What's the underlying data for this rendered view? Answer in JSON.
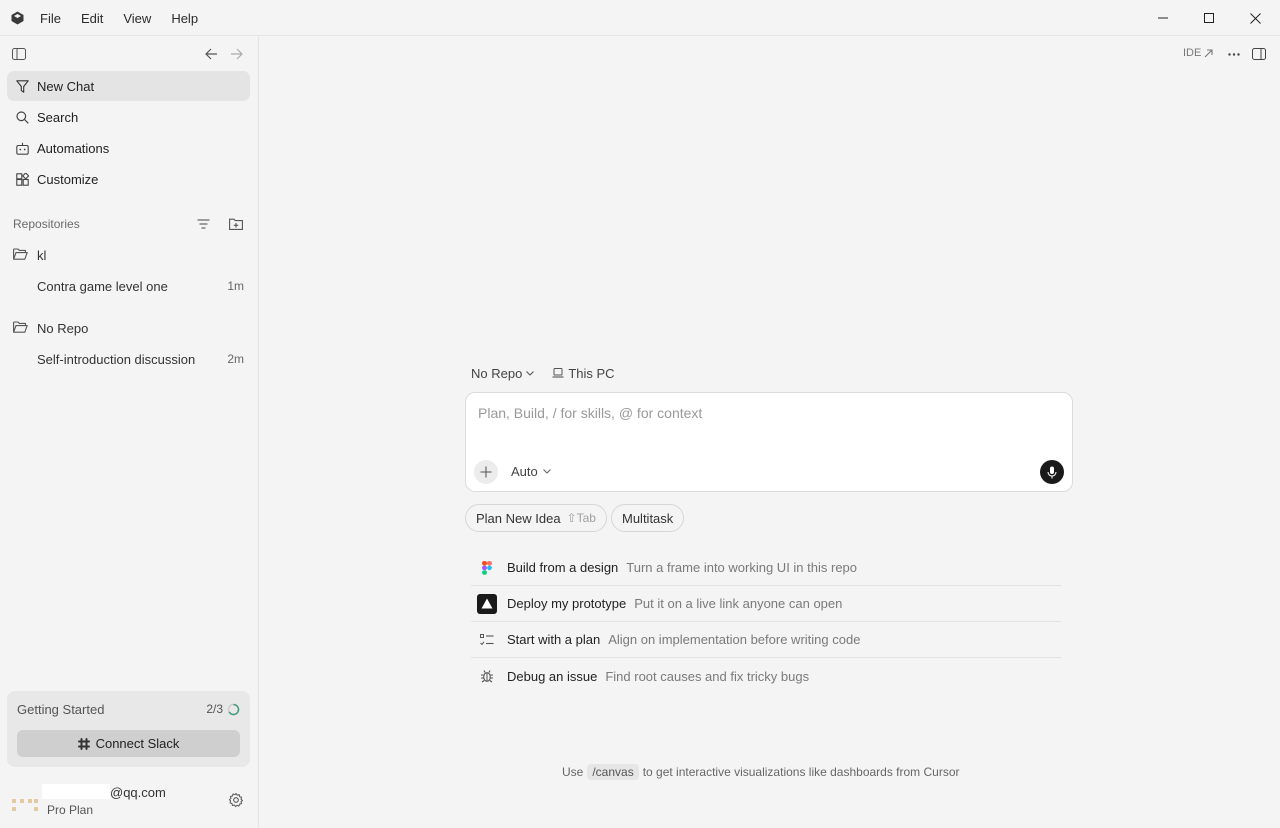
{
  "menu": [
    "File",
    "Edit",
    "View",
    "Help"
  ],
  "sidebar": {
    "nav": [
      {
        "label": "New Chat",
        "icon": "new-chat-icon",
        "active": true
      },
      {
        "label": "Search",
        "icon": "search-icon"
      },
      {
        "label": "Automations",
        "icon": "automations-icon"
      },
      {
        "label": "Customize",
        "icon": "customize-icon"
      }
    ],
    "repositories_title": "Repositories",
    "repos": [
      {
        "name": "kl",
        "chats": [
          {
            "title": "Contra game level one",
            "time": "1m"
          }
        ]
      },
      {
        "name": "No Repo",
        "chats": [
          {
            "title": "Self-introduction discussion",
            "time": "2m"
          }
        ]
      }
    ],
    "getting_started": {
      "title": "Getting Started",
      "progress": "2/3",
      "button": "Connect Slack"
    },
    "account": {
      "email": "@qq.com",
      "plan": "Pro Plan"
    }
  },
  "main": {
    "ide_link": "IDE",
    "context": {
      "repo": "No Repo",
      "location": "This PC"
    },
    "composer": {
      "placeholder": "Plan, Build, / for skills, @ for context",
      "mode": "Auto"
    },
    "chips": [
      {
        "label": "Plan New Idea",
        "hint": "⇧Tab"
      },
      {
        "label": "Multitask"
      }
    ],
    "suggestions": [
      {
        "title": "Build from a design",
        "desc": "Turn a frame into working UI in this repo",
        "icon": "figma-icon"
      },
      {
        "title": "Deploy my prototype",
        "desc": "Put it on a live link anyone can open",
        "icon": "vercel-icon"
      },
      {
        "title": "Start with a plan",
        "desc": "Align on implementation before writing code",
        "icon": "plan-list-icon"
      },
      {
        "title": "Debug an issue",
        "desc": "Find root causes and fix tricky bugs",
        "icon": "bug-icon"
      }
    ],
    "footer": {
      "prefix": "Use",
      "code": "/canvas",
      "suffix": "to get interactive visualizations like dashboards from Cursor"
    }
  },
  "colors": {
    "background": "#f4f4f4",
    "active_item": "#e4e4e4",
    "composer_bg": "#ffffff",
    "mic_bg": "#1a1a1a"
  }
}
